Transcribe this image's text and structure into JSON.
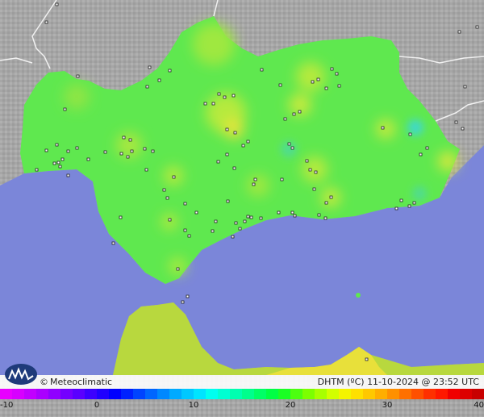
{
  "map": {
    "colors": {
      "land_outside": "#a9a9a9",
      "sea": "#7b86d9",
      "andalusia_base": "#5fe84f",
      "warm": "#b8ea3f",
      "hot": "#e8e43a",
      "cool": "#4fdc92"
    }
  },
  "footer": {
    "copyright": "©",
    "brand": "Meteoclimatic",
    "product": "DHTM (ºC)  11-10-2024 @ 23:52 UTC"
  },
  "scale": {
    "ticks": [
      "-10",
      "0",
      "10",
      "20",
      "30",
      "40"
    ],
    "colors": [
      "#e800ff",
      "#d700ff",
      "#c100ff",
      "#aa00ff",
      "#9000ff",
      "#7400ff",
      "#5a00ff",
      "#3c00ff",
      "#2000ff",
      "#0000ff",
      "#0021ff",
      "#0044ff",
      "#0066ff",
      "#0088ff",
      "#00aaff",
      "#00c8ff",
      "#00e4ff",
      "#00fff0",
      "#00ffd2",
      "#00ffb0",
      "#00ff8c",
      "#00ff66",
      "#00ff44",
      "#1aff24",
      "#4cff10",
      "#7cff00",
      "#a8ff00",
      "#d2ff00",
      "#f4f400",
      "#ffe000",
      "#ffc800",
      "#ffae00",
      "#ff9000",
      "#ff7000",
      "#ff5000",
      "#ff3000",
      "#ff1800",
      "#f00000",
      "#dd0000",
      "#c80000"
    ]
  }
}
